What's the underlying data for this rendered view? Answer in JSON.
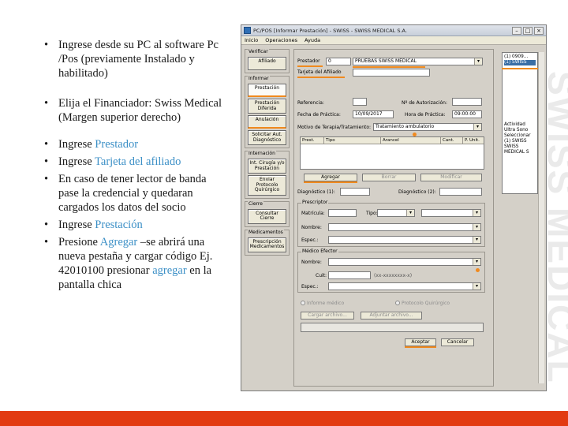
{
  "slide": {
    "bullets": [
      {
        "text": "Ingrese  desde su PC al software  Pc /Pos (previamente Instalado y habilitado)"
      },
      {
        "text": "Elija el Financiador: Swiss Medical (Margen superior derecho)"
      },
      {
        "pre": "Ingrese ",
        "hl": "Prestador",
        "post": ""
      },
      {
        "pre": "Ingrese ",
        "hl": "Tarjeta del afiliado",
        "post": ""
      },
      {
        "text": "En caso de tener lector de banda pase la credencial y quedaran cargados los datos del socio"
      },
      {
        "pre": "Ingrese ",
        "hl": "Prestación",
        "post": ""
      },
      {
        "pre": "Presione ",
        "hl": "Agregar",
        "post": " –se abrirá una nueva pestaña y cargar código Ej. 42010100 presionar ",
        "hl2": "agregar",
        "post2": " en la pantalla chica"
      }
    ],
    "watermark": "SWISS MEDICAL",
    "colors": {
      "highlight": "#3b8fc6",
      "footer": "#e23b12",
      "accent": "#f08a1e"
    }
  },
  "window": {
    "title": "PC/POS [Informar Prestación] - SWISS - SWISS MEDICAL S.A.",
    "controls": [
      "–",
      "□",
      "×"
    ],
    "menu": [
      "Inicio",
      "Operaciones",
      "Ayuda"
    ]
  },
  "nav": {
    "groups": [
      {
        "title": "Verificar",
        "buttons": [
          "Afiliado"
        ]
      },
      {
        "title": "Informar",
        "buttons": [
          "Prestación",
          "Prestación Diferida",
          "Anulación",
          "Solicitar Aut. Diagnóstico"
        ]
      },
      {
        "title": "Internación",
        "buttons": [
          "Int. Cirugía y/o Prestación",
          "Enviar Protocolo Quirúrgico"
        ]
      },
      {
        "title": "Cierre",
        "buttons": [
          "Consultar Cierre"
        ]
      },
      {
        "title": "Medicamentos",
        "buttons": [
          "Prescripción Medicamentos"
        ]
      }
    ]
  },
  "form": {
    "prestador_label": "Prestador",
    "prestador_code": "0",
    "prestador_name": "PRUEBAS SWISS MEDICAL",
    "tarjeta_label": "Tarjeta del Afiliado",
    "referencia_label": "Referencia:",
    "nro_autorizacion_label": "Nº de Autorización:",
    "fecha_label": "Fecha de Práctica:",
    "fecha_value": "10/09/2017",
    "hora_label": "Hora de Práctica:",
    "hora_value": "09:00:00",
    "motivo_label": "Motivo de Terapia/Tratamiento:",
    "motivo_value": "Tratamiento ambulatorio",
    "grid_columns": [
      "Prest.",
      "Tipo",
      "Arancel",
      "Cant.",
      "P. Unit."
    ],
    "agregar": "Agregar",
    "borrar": "Borrar",
    "modificar": "Modificar",
    "diag1_label": "Diagnóstico (1):",
    "diag2_label": "Diagnóstico (2):",
    "prescriptor_title": "Prescriptor",
    "matricula_label": "Matrícula:",
    "tipo_label": "Tipo:",
    "nombre_label": "Nombre:",
    "espec_label": "Espec.:",
    "medico_title": "Médico Efector",
    "nombre2_label": "Nombre:",
    "cuit_label": "Cuit:",
    "cuit_placeholder": "(xx-xxxxxxxx-x)",
    "espec2_label": "Espec.:",
    "radio1": "Informe médico",
    "radio2": "Protocolo Quirúrgico",
    "btn_cargar": "Cargar archivo...",
    "btn_adjuntar": "Adjuntar archivo...",
    "aceptar": "Aceptar",
    "cancelar": "Cancelar"
  },
  "right_list": [
    "(1) 0909...",
    "(1) SWISS",
    "Actividad",
    "Ultra Sono",
    "Seleccionar",
    "(1) SWISS",
    "SWISS",
    "MEDICAL S"
  ]
}
